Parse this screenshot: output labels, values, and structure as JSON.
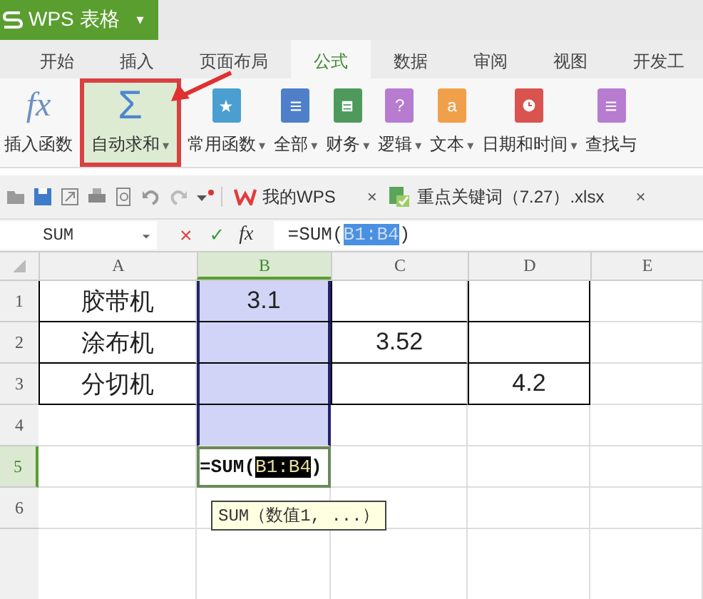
{
  "app": {
    "title": "WPS 表格",
    "menu_caret": "▾"
  },
  "tabs": [
    {
      "label": "开始",
      "selected": false
    },
    {
      "label": "插入",
      "selected": false
    },
    {
      "label": "页面布局",
      "selected": false
    },
    {
      "label": "公式",
      "selected": true
    },
    {
      "label": "数据",
      "selected": false
    },
    {
      "label": "审阅",
      "selected": false
    },
    {
      "label": "视图",
      "selected": false
    },
    {
      "label": "开发工",
      "selected": false
    }
  ],
  "ribbon": [
    {
      "label": "插入函数",
      "kind": "fx",
      "glyph": "fx",
      "dropdown": false,
      "highlighted": false
    },
    {
      "label": "自动求和",
      "kind": "sigma",
      "glyph": "Σ",
      "dropdown": true,
      "highlighted": true
    },
    {
      "label": "常用函数",
      "kind": "star",
      "color": "#4a9fd0",
      "dropdown": true,
      "highlighted": false
    },
    {
      "label": "全部",
      "kind": "list",
      "color": "#4f7fc9",
      "dropdown": true,
      "highlighted": false
    },
    {
      "label": "财务",
      "kind": "ledger",
      "color": "#4e9a5c",
      "dropdown": true,
      "highlighted": false
    },
    {
      "label": "逻辑",
      "kind": "glyph",
      "glyph": "?",
      "color": "#b77bd0",
      "dropdown": true,
      "highlighted": false
    },
    {
      "label": "文本",
      "kind": "glyph",
      "glyph": "a",
      "color": "#f0a04b",
      "dropdown": true,
      "highlighted": false
    },
    {
      "label": "日期和时间",
      "kind": "clock",
      "color": "#d9534f",
      "dropdown": true,
      "highlighted": false
    },
    {
      "label": "查找与",
      "kind": "list",
      "color": "#b77bd0",
      "dropdown": false,
      "highlighted": false
    }
  ],
  "doc_tabs": [
    {
      "label": "我的WPS",
      "kind": "home",
      "close": "×"
    },
    {
      "label": "重点关键词（7.27）.xlsx",
      "kind": "workbook",
      "close": "×"
    }
  ],
  "formula_bar": {
    "name_box": "SUM",
    "cancel": "×",
    "confirm": "✓",
    "fx": "fx",
    "before": "=SUM(",
    "reference": "B1:B4",
    "after": ")"
  },
  "sheet": {
    "columns": [
      {
        "label": "A",
        "selected": false
      },
      {
        "label": "B",
        "selected": true
      },
      {
        "label": "C",
        "selected": false
      },
      {
        "label": "D",
        "selected": false
      },
      {
        "label": "E",
        "selected": false
      }
    ],
    "rows": [
      {
        "header": "1",
        "selected": false,
        "bordered": true,
        "in_range": true,
        "cells": [
          "胶带机",
          "3.1",
          null,
          null,
          null
        ]
      },
      {
        "header": "2",
        "selected": false,
        "bordered": true,
        "in_range": true,
        "cells": [
          "涂布机",
          null,
          "3.52",
          null,
          null
        ]
      },
      {
        "header": "3",
        "selected": false,
        "bordered": true,
        "in_range": true,
        "cells": [
          "分切机",
          null,
          null,
          "4.2",
          null
        ]
      },
      {
        "header": "4",
        "selected": false,
        "bordered": false,
        "in_range": true,
        "cells": [
          null,
          null,
          null,
          null,
          null
        ]
      },
      {
        "header": "5",
        "selected": true,
        "bordered": false,
        "in_range": false,
        "cells": [
          null,
          null,
          null,
          null,
          null
        ]
      },
      {
        "header": "6",
        "selected": false,
        "bordered": false,
        "in_range": false,
        "cells": [
          null,
          null,
          null,
          null,
          null
        ]
      }
    ],
    "editing": {
      "before": "=SUM(",
      "reference": "B1:B4",
      "after": ")"
    },
    "tooltip": "SUM（数值1, ...）"
  }
}
